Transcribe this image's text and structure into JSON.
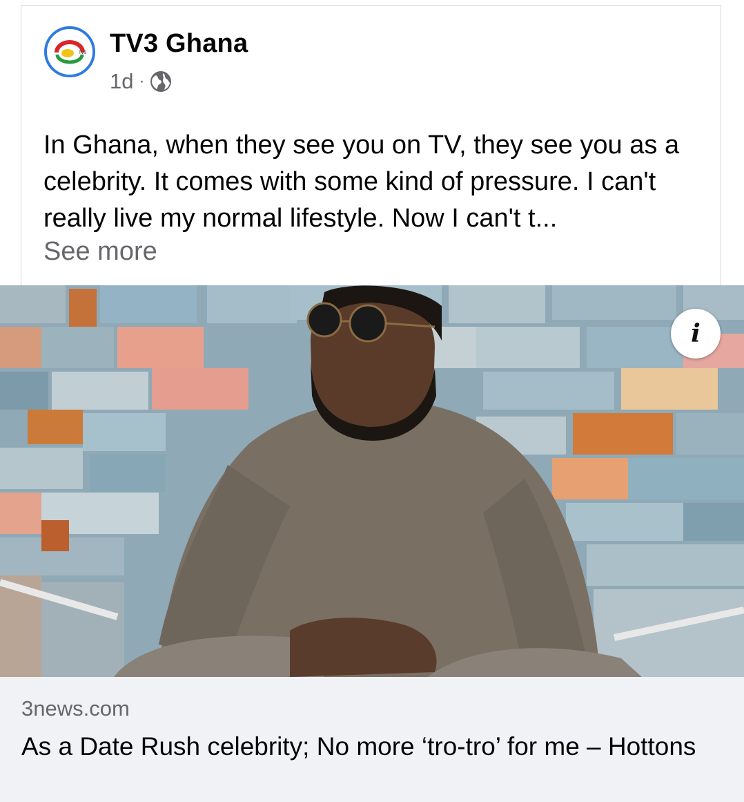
{
  "post": {
    "page_name": "TV3 Ghana",
    "time": "1d",
    "separator": "·",
    "privacy_icon": "globe-icon",
    "text": "In Ghana, when they see you on TV, they see you as a celebrity. It comes with some kind of pressure. I can't really live my normal lifestyle. Now I can't t...",
    "see_more": "See more"
  },
  "avatar": {
    "logo_text": "TV3",
    "ring_color": "#2f7be0"
  },
  "media": {
    "info_label": "i",
    "info_icon": "info-icon"
  },
  "link_preview": {
    "domain": "3news.com",
    "headline": "As a Date Rush celebrity; No more ‘tro-tro’ for me – Hottons"
  },
  "colors": {
    "text": "#050505",
    "secondary": "#65676b",
    "preview_bg": "#f0f2f5"
  }
}
